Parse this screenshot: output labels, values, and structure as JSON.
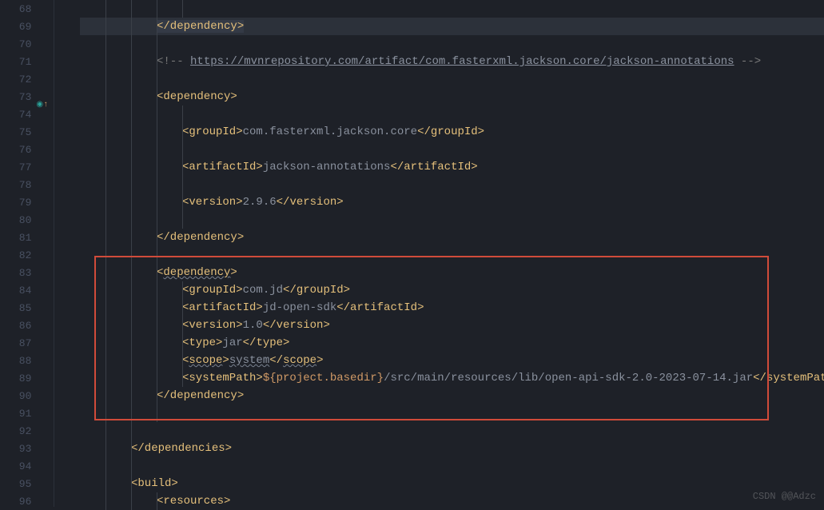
{
  "watermark": "CSDN @@Adzc",
  "lines": [
    {
      "num": 68,
      "indent": 4,
      "segs": []
    },
    {
      "num": 69,
      "indent": 3,
      "current": true,
      "segs": [
        {
          "t": "tag",
          "v": "</dependency>",
          "sel": true
        }
      ]
    },
    {
      "num": 70,
      "indent": 3,
      "segs": []
    },
    {
      "num": 71,
      "indent": 3,
      "segs": [
        {
          "t": "comment",
          "v": "<!-- "
        },
        {
          "t": "url",
          "v": "https://mvnrepository.com/artifact/com.fasterxml.jackson.core/jackson-annotations"
        },
        {
          "t": "comment",
          "v": " -->"
        }
      ]
    },
    {
      "num": 72,
      "indent": 3,
      "segs": []
    },
    {
      "num": 73,
      "indent": 3,
      "marker": "mod",
      "segs": [
        {
          "t": "tag",
          "v": "<dependency>"
        }
      ]
    },
    {
      "num": 74,
      "indent": 4,
      "segs": []
    },
    {
      "num": 75,
      "indent": 4,
      "segs": [
        {
          "t": "tag",
          "v": "<groupId>"
        },
        {
          "t": "text",
          "v": "com.fasterxml.jackson.core"
        },
        {
          "t": "tag",
          "v": "</groupId>"
        }
      ]
    },
    {
      "num": 76,
      "indent": 4,
      "segs": []
    },
    {
      "num": 77,
      "indent": 4,
      "segs": [
        {
          "t": "tag",
          "v": "<artifactId>"
        },
        {
          "t": "text",
          "v": "jackson-annotations"
        },
        {
          "t": "tag",
          "v": "</artifactId>"
        }
      ]
    },
    {
      "num": 78,
      "indent": 4,
      "segs": []
    },
    {
      "num": 79,
      "indent": 4,
      "segs": [
        {
          "t": "tag",
          "v": "<version>"
        },
        {
          "t": "text",
          "v": "2.9.6"
        },
        {
          "t": "tag",
          "v": "</version>"
        }
      ]
    },
    {
      "num": 80,
      "indent": 4,
      "segs": []
    },
    {
      "num": 81,
      "indent": 3,
      "segs": [
        {
          "t": "tag",
          "v": "</dependency>"
        }
      ]
    },
    {
      "num": 82,
      "indent": 3,
      "segs": []
    },
    {
      "num": 83,
      "indent": 3,
      "hl": "start",
      "segs": [
        {
          "t": "tago",
          "v": "<"
        },
        {
          "t": "sq",
          "v": "dependency"
        },
        {
          "t": "tago",
          "v": ">"
        }
      ]
    },
    {
      "num": 84,
      "indent": 4,
      "segs": [
        {
          "t": "tag",
          "v": "<groupId>"
        },
        {
          "t": "text",
          "v": "com.jd"
        },
        {
          "t": "tag",
          "v": "</groupId>"
        }
      ]
    },
    {
      "num": 85,
      "indent": 4,
      "segs": [
        {
          "t": "tag",
          "v": "<artifactId>"
        },
        {
          "t": "text",
          "v": "jd-open-sdk"
        },
        {
          "t": "tag",
          "v": "</artifactId>"
        }
      ]
    },
    {
      "num": 86,
      "indent": 4,
      "segs": [
        {
          "t": "tag",
          "v": "<version>"
        },
        {
          "t": "text",
          "v": "1.0"
        },
        {
          "t": "tag",
          "v": "</version>"
        }
      ]
    },
    {
      "num": 87,
      "indent": 4,
      "segs": [
        {
          "t": "tag",
          "v": "<type>"
        },
        {
          "t": "text",
          "v": "jar"
        },
        {
          "t": "tag",
          "v": "</type>"
        }
      ]
    },
    {
      "num": 88,
      "indent": 4,
      "segs": [
        {
          "t": "tago",
          "v": "<"
        },
        {
          "t": "sq",
          "v": "scope"
        },
        {
          "t": "tago",
          "v": ">"
        },
        {
          "t": "sqtext",
          "v": "system"
        },
        {
          "t": "tago",
          "v": "</"
        },
        {
          "t": "sq",
          "v": "scope"
        },
        {
          "t": "tago",
          "v": ">"
        }
      ]
    },
    {
      "num": 89,
      "indent": 4,
      "segs": [
        {
          "t": "tag",
          "v": "<systemPath>"
        },
        {
          "t": "var",
          "v": "${project.basedir}"
        },
        {
          "t": "text",
          "v": "/src/main/resources/lib/open-api-sdk-2.0-2023-07-14.jar"
        },
        {
          "t": "tag",
          "v": "</systemPath>"
        }
      ]
    },
    {
      "num": 90,
      "indent": 3,
      "hl": "end",
      "segs": [
        {
          "t": "tag",
          "v": "</dependency>"
        }
      ]
    },
    {
      "num": 91,
      "indent": 3,
      "segs": []
    },
    {
      "num": 92,
      "indent": 2,
      "segs": []
    },
    {
      "num": 93,
      "indent": 2,
      "segs": [
        {
          "t": "tag",
          "v": "</dependencies>"
        }
      ]
    },
    {
      "num": 94,
      "indent": 2,
      "segs": []
    },
    {
      "num": 95,
      "indent": 2,
      "segs": [
        {
          "t": "tag",
          "v": "<build>"
        }
      ]
    },
    {
      "num": 96,
      "indent": 3,
      "segs": [
        {
          "t": "tag",
          "v": "<resources>"
        }
      ]
    }
  ],
  "highlight_box": {
    "top_line": 83,
    "bottom_line": 90
  }
}
